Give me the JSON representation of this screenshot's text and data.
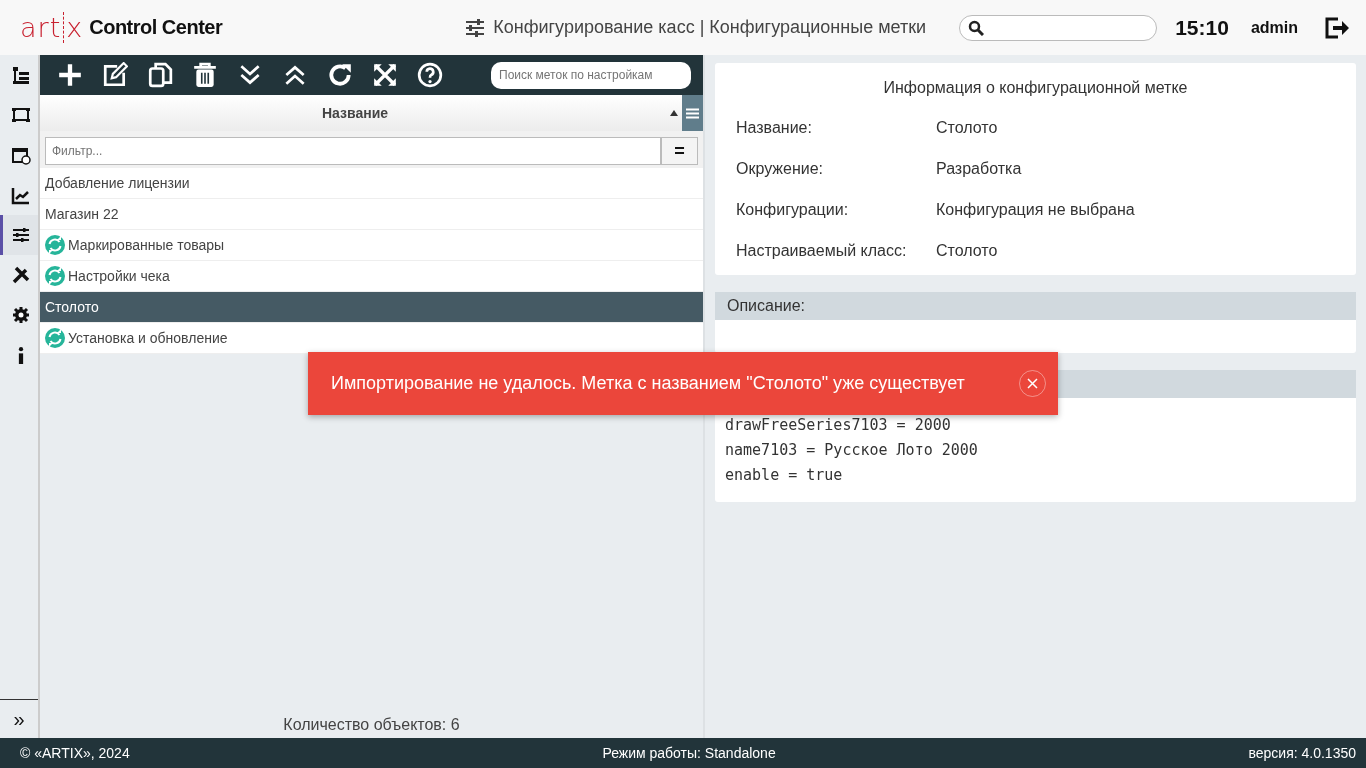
{
  "header": {
    "logo": "art",
    "logo_end": "x",
    "app_name": "Control Center",
    "page_title": "Конфигурирование касс | Конфигурационные метки",
    "time": "15:10",
    "user": "admin"
  },
  "sidebar": {
    "items": [
      {
        "selected": false
      },
      {
        "selected": false
      },
      {
        "selected": false
      },
      {
        "selected": false
      },
      {
        "selected": true
      },
      {
        "selected": false
      },
      {
        "selected": false
      },
      {
        "selected": false
      }
    ],
    "expand": "»"
  },
  "toolbar": {
    "search": {
      "placeholder": "Поиск меток по настройкам"
    }
  },
  "list": {
    "column": "Название",
    "filter": {
      "placeholder": "Фильтр...",
      "button": "="
    },
    "rows": [
      {
        "name": "Добавление лицензии",
        "synced": false,
        "selected": false
      },
      {
        "name": "Магазин 22",
        "synced": false,
        "selected": false
      },
      {
        "name": "Маркированные товары",
        "synced": true,
        "selected": false
      },
      {
        "name": "Настройки чека",
        "synced": true,
        "selected": false
      },
      {
        "name": "Столото",
        "synced": false,
        "selected": true
      },
      {
        "name": "Установка и обновление",
        "synced": true,
        "selected": false
      }
    ],
    "count": "Количество объектов: 6"
  },
  "info": {
    "title": "Информация о конфигурационной метке",
    "fields": [
      {
        "label": "Название:",
        "value": "Столото"
      },
      {
        "label": "Окружение:",
        "value": "Разработка"
      },
      {
        "label": "Конфигурации:",
        "value": "Конфигурация не выбрана"
      },
      {
        "label": "Настраиваемый класс:",
        "value": "Столото"
      }
    ]
  },
  "description": {
    "title": "Описание:"
  },
  "settings": {
    "lines": [
      "drawFreeSeries7103 = 2000",
      "name7103 = Русское Лото 2000",
      "enable = true"
    ]
  },
  "toast": {
    "message": "Импортирование не удалось. Метка с названием \"Столото\" уже существует"
  },
  "status_bar": {
    "copyright": "© «ARTIX», 2024",
    "mode": "Режим работы: Standalone",
    "version": "версия: 4.0.1350"
  }
}
